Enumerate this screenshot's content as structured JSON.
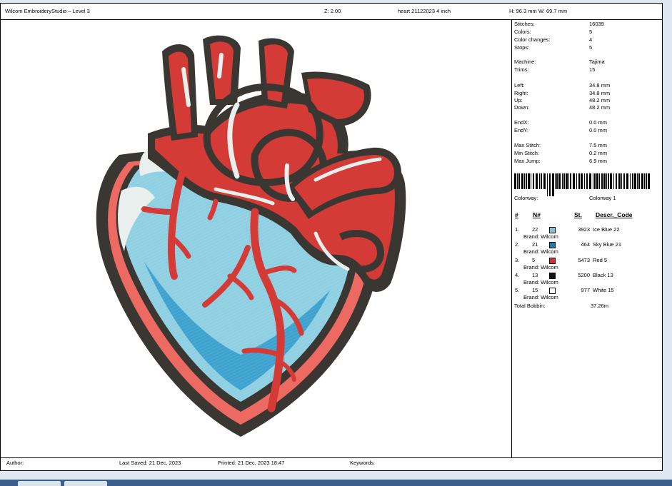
{
  "title": {
    "app": "Wilcom EmbroideryStudio – Level 3",
    "zoom": "Z: 2.00",
    "file": "heart 21122023 4 inch",
    "size": "H: 96.3 mm   W: 69.7 mm"
  },
  "stats": [
    {
      "label": "Stitches:",
      "value": "16039"
    },
    {
      "label": "Colors:",
      "value": "5"
    },
    {
      "label": "Color changes:",
      "value": "4"
    },
    {
      "label": "Stops:",
      "value": "5"
    },
    {
      "label": "Machine:",
      "value": "Tajima"
    },
    {
      "label": "Trims:",
      "value": "15"
    },
    {
      "label": "Left:",
      "value": "34.8 mm"
    },
    {
      "label": "Right:",
      "value": "34.8 mm"
    },
    {
      "label": "Up:",
      "value": "48.2 mm"
    },
    {
      "label": "Down:",
      "value": "48.2 mm"
    },
    {
      "label": "EndX:",
      "value": "0.0 mm"
    },
    {
      "label": "EndY:",
      "value": "0.0 mm"
    },
    {
      "label": "Max Stitch:",
      "value": "7.5 mm"
    },
    {
      "label": "Min Stitch:",
      "value": "0.2 mm"
    },
    {
      "label": "Max Jump:",
      "value": "6.9 mm"
    }
  ],
  "colorway": {
    "label": "Colorway:",
    "value": "Colorway 1"
  },
  "table_headers": {
    "num": "#",
    "code": "N#",
    "stitches": "St.",
    "desc": "Descr._Code"
  },
  "colors": [
    {
      "index": "1.",
      "code": "22",
      "stitches": "3923",
      "name": "Ice Blue 22",
      "brand": "Brand: Wilcom",
      "color": "#7fc4dc"
    },
    {
      "index": "2.",
      "code": "21",
      "stitches": "464",
      "name": "Sky Blue 21",
      "brand": "Brand: Wilcom",
      "color": "#1f78b4"
    },
    {
      "index": "3.",
      "code": "5",
      "stitches": "5473",
      "name": "Red 5",
      "brand": "Brand: Wilcom",
      "color": "#d42e2e"
    },
    {
      "index": "4.",
      "code": "13",
      "stitches": "5200",
      "name": "Black 13",
      "brand": "Brand: Wilcom",
      "color": "#111111"
    },
    {
      "index": "5.",
      "code": "15",
      "stitches": "977",
      "name": "White 15",
      "brand": "Brand: Wilcom",
      "color": "#ffffff"
    }
  ],
  "bobbin": {
    "label": "Total Bobbin:",
    "value": "37.26m"
  },
  "footer": {
    "author": "Author:",
    "saved": "Last Saved: 21 Dec, 2023",
    "printed": "Printed: 21 Dec, 2023 18:47",
    "keywords": "Keywords:"
  }
}
